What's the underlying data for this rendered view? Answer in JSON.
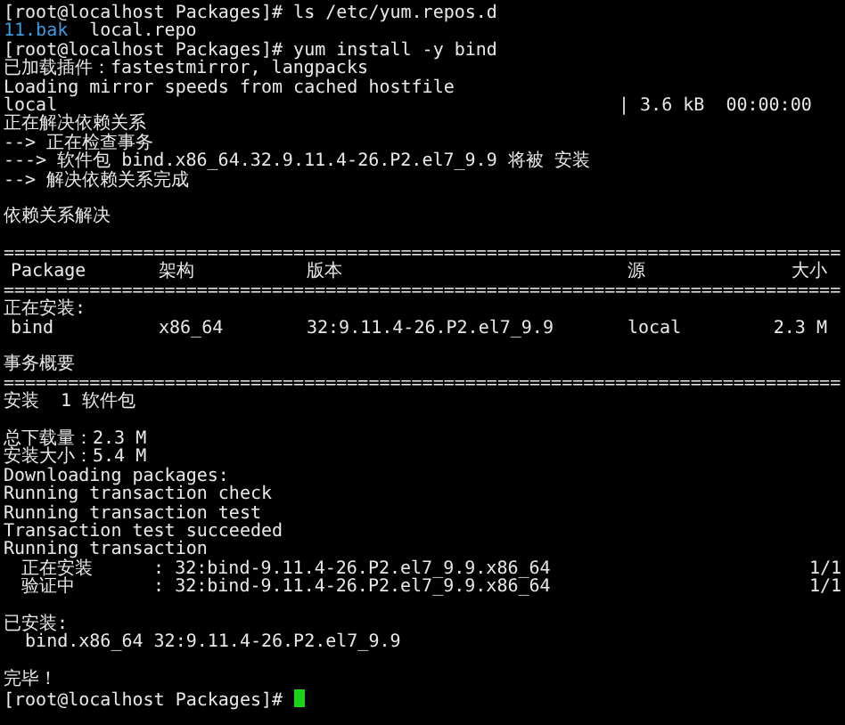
{
  "lines": [
    {
      "kind": "text",
      "text": "[root@localhost Packages]# ls /etc/yum.repos.d"
    },
    {
      "kind": "listing",
      "items": [
        {
          "text": "11.bak",
          "color": "#3d9be0"
        },
        {
          "text": "local.repo",
          "color": "#e8e8e8"
        }
      ]
    },
    {
      "kind": "text",
      "text": "[root@localhost Packages]# yum install -y bind"
    },
    {
      "kind": "text",
      "text": "已加载插件：fastestmirror, langpacks"
    },
    {
      "kind": "text",
      "text": "Loading mirror speeds from cached hostfile"
    },
    {
      "kind": "status",
      "cells": [
        "local",
        "| 3.6 kB  00:00:00"
      ]
    },
    {
      "kind": "text",
      "text": "正在解决依赖关系"
    },
    {
      "kind": "text",
      "text": "--> 正在检查事务"
    },
    {
      "kind": "text",
      "text": "---> 软件包 bind.x86_64.32.9.11.4-26.P2.el7_9.9 将被 安装"
    },
    {
      "kind": "text",
      "text": "--> 解决依赖关系完成"
    },
    {
      "kind": "blank"
    },
    {
      "kind": "text",
      "text": "依赖关系解决"
    },
    {
      "kind": "blank"
    },
    {
      "kind": "rule",
      "text": "=============================================================================="
    },
    {
      "kind": "table",
      "cells": [
        "Package",
        "架构",
        "版本",
        "源",
        "大小"
      ]
    },
    {
      "kind": "rule",
      "text": "=============================================================================="
    },
    {
      "kind": "text",
      "text": "正在安装:"
    },
    {
      "kind": "table",
      "cells": [
        "bind",
        "x86_64",
        "32:9.11.4-26.P2.el7_9.9",
        "local",
        "2.3 M"
      ]
    },
    {
      "kind": "blank"
    },
    {
      "kind": "text",
      "text": "事务概要"
    },
    {
      "kind": "rule",
      "text": "=============================================================================="
    },
    {
      "kind": "text",
      "text": "安装  1 软件包"
    },
    {
      "kind": "blank"
    },
    {
      "kind": "text",
      "text": "总下载量：2.3 M"
    },
    {
      "kind": "text",
      "text": "安装大小：5.4 M"
    },
    {
      "kind": "text",
      "text": "Downloading packages:"
    },
    {
      "kind": "text",
      "text": "Running transaction check"
    },
    {
      "kind": "text",
      "text": "Running transaction test"
    },
    {
      "kind": "text",
      "text": "Transaction test succeeded"
    },
    {
      "kind": "text",
      "text": "Running transaction"
    },
    {
      "kind": "progress",
      "cells": [
        "正在安装",
        "  : 32:bind-9.11.4-26.P2.el7_9.9.x86_64",
        "1/1"
      ]
    },
    {
      "kind": "progress",
      "cells": [
        "验证中",
        "  : 32:bind-9.11.4-26.P2.el7_9.9.x86_64",
        "1/1"
      ]
    },
    {
      "kind": "blank"
    },
    {
      "kind": "text",
      "text": "已安装:"
    },
    {
      "kind": "text",
      "text": "  bind.x86_64 32:9.11.4-26.P2.el7_9.9"
    },
    {
      "kind": "blank"
    },
    {
      "kind": "text",
      "text": "完毕！"
    },
    {
      "kind": "prompt",
      "text": "[root@localhost Packages]# "
    }
  ]
}
